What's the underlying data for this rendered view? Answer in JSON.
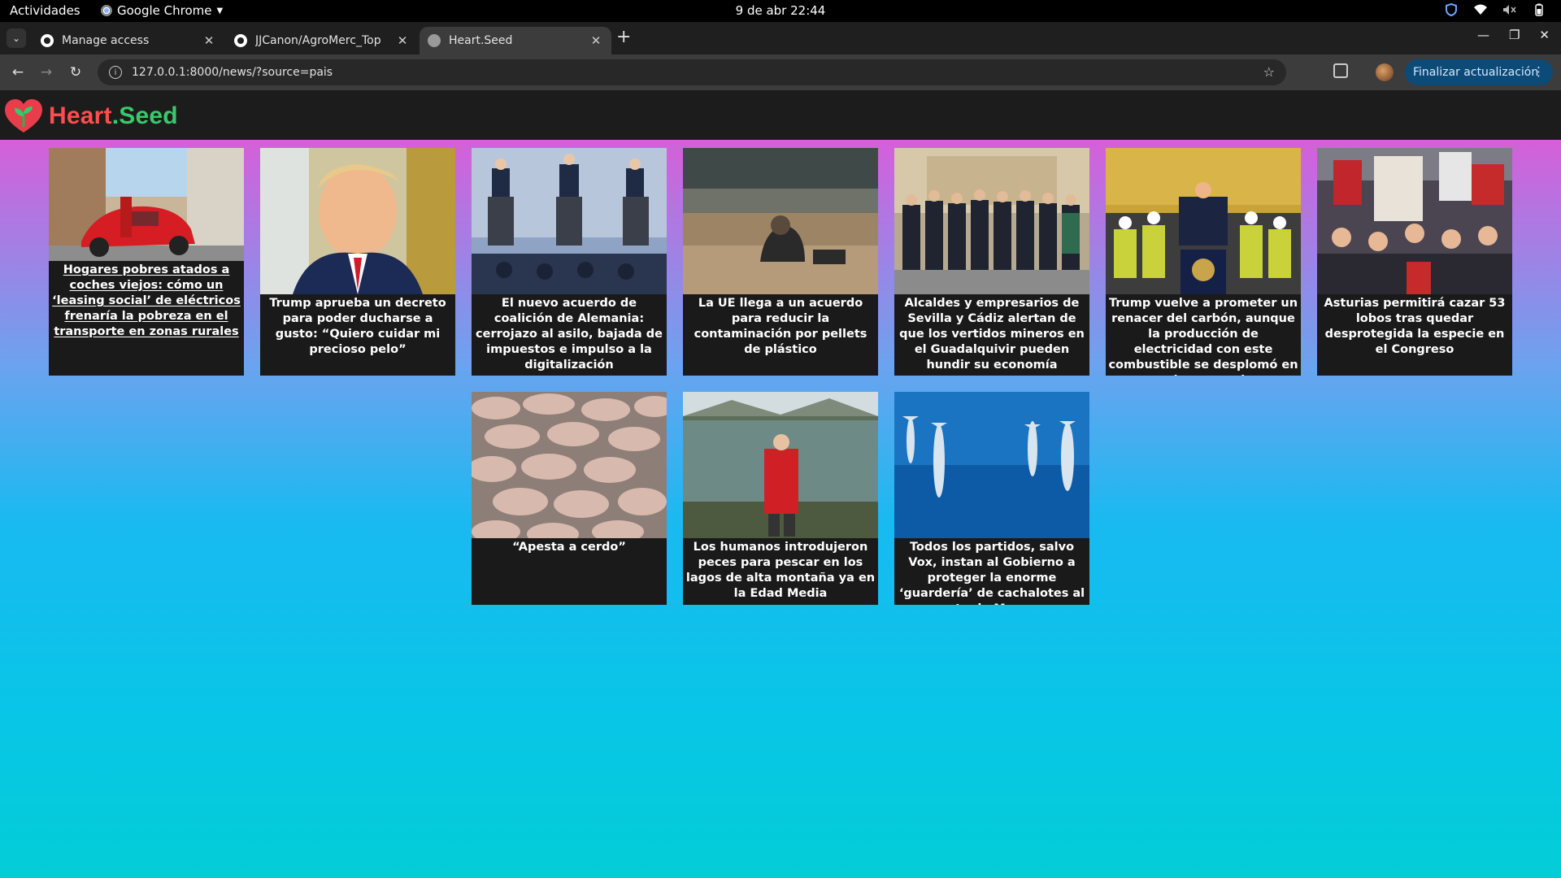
{
  "system_bar": {
    "activities": "Actividades",
    "app_name": "Google Chrome",
    "clock": "9 de abr  22:44"
  },
  "browser": {
    "tabs": [
      {
        "title": "Manage access",
        "icon": "github-icon",
        "active": false
      },
      {
        "title": "JJCanon/AgroMerc_Top",
        "icon": "github-icon",
        "active": false
      },
      {
        "title": "Heart.Seed",
        "icon": "globe-icon",
        "active": true
      }
    ],
    "url": "127.0.0.1:8000/news/?source=pais",
    "update_button": "Finalizar actualización"
  },
  "site": {
    "logo_part1": "Heart",
    "logo_part2": ".Seed",
    "colors": {
      "logo_red": "#ff4d4d",
      "logo_green": "#39c96b",
      "header_bg": "#1c1c1c",
      "card_bg": "#1a1a1a"
    }
  },
  "news": [
    {
      "title": "Hogares pobres atados a coches viejos: cómo un ‘leasing social’ de eléctricos frenaría la pobreza en el transporte en zonas rurales",
      "image": "red-electric-car-street-photo"
    },
    {
      "title": "Trump aprueba un decreto para poder ducharse a gusto: “Quiero cuidar mi precioso pelo”",
      "image": "trump-portrait-photo"
    },
    {
      "title": "El nuevo acuerdo de coalición de Alemania: cerrojazo al asilo, bajada de impuestos e impulso a la digitalización",
      "image": "press-conference-photo"
    },
    {
      "title": "La UE llega a un acuerdo para reducir la contaminación por pellets de plástico",
      "image": "beach-pellets-photo"
    },
    {
      "title": "Alcaldes y empresarios de Sevilla y Cádiz alertan de que los vertidos mineros en el Guadalquivir pueden hundir su economía",
      "image": "mayors-group-photo"
    },
    {
      "title": "Trump vuelve a prometer un renacer del carbón, aunque la producción de electricidad con este combustible se desplomó en su primer mandato",
      "image": "coal-miners-event-photo"
    },
    {
      "title": "Asturias permitirá cazar 53 lobos tras quedar desprotegida la especie en el Congreso",
      "image": "wolf-protest-photo"
    },
    {
      "title": "“Apesta a cerdo”",
      "image": "pig-farm-photo"
    },
    {
      "title": "Los humanos introdujeron peces para pescar en los lagos de alta montaña ya en la Edad Media",
      "image": "mountain-lake-photo"
    },
    {
      "title": "Todos los partidos, salvo Vox, instan al Gobierno a proteger la enorme ‘guardería’ de cachalotes al norte de Menorca",
      "image": "sperm-whales-photo"
    }
  ]
}
